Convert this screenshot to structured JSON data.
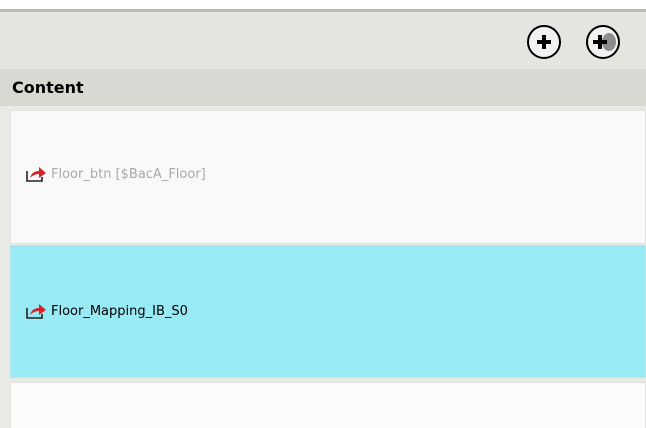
{
  "toolbar": {
    "add_icon": "circle-plus-icon",
    "add_multiple_icon": "circle-plus-multiple-icon"
  },
  "content_panel": {
    "header": "Content",
    "rows": [
      {
        "label": "Floor_btn [$BacA_Floor]",
        "icon": "link-arrow-icon",
        "state": "disabled"
      },
      {
        "label": "Floor_Mapping_IB_S0",
        "icon": "link-arrow-icon",
        "state": "selected"
      },
      {
        "label": "",
        "icon": "",
        "state": "empty"
      }
    ]
  },
  "colors": {
    "toolbar_bg": "#e4e4e1",
    "header_bg": "#d9d9d4",
    "selected_row": "#98ebf5",
    "icon_red": "#d6232a"
  }
}
